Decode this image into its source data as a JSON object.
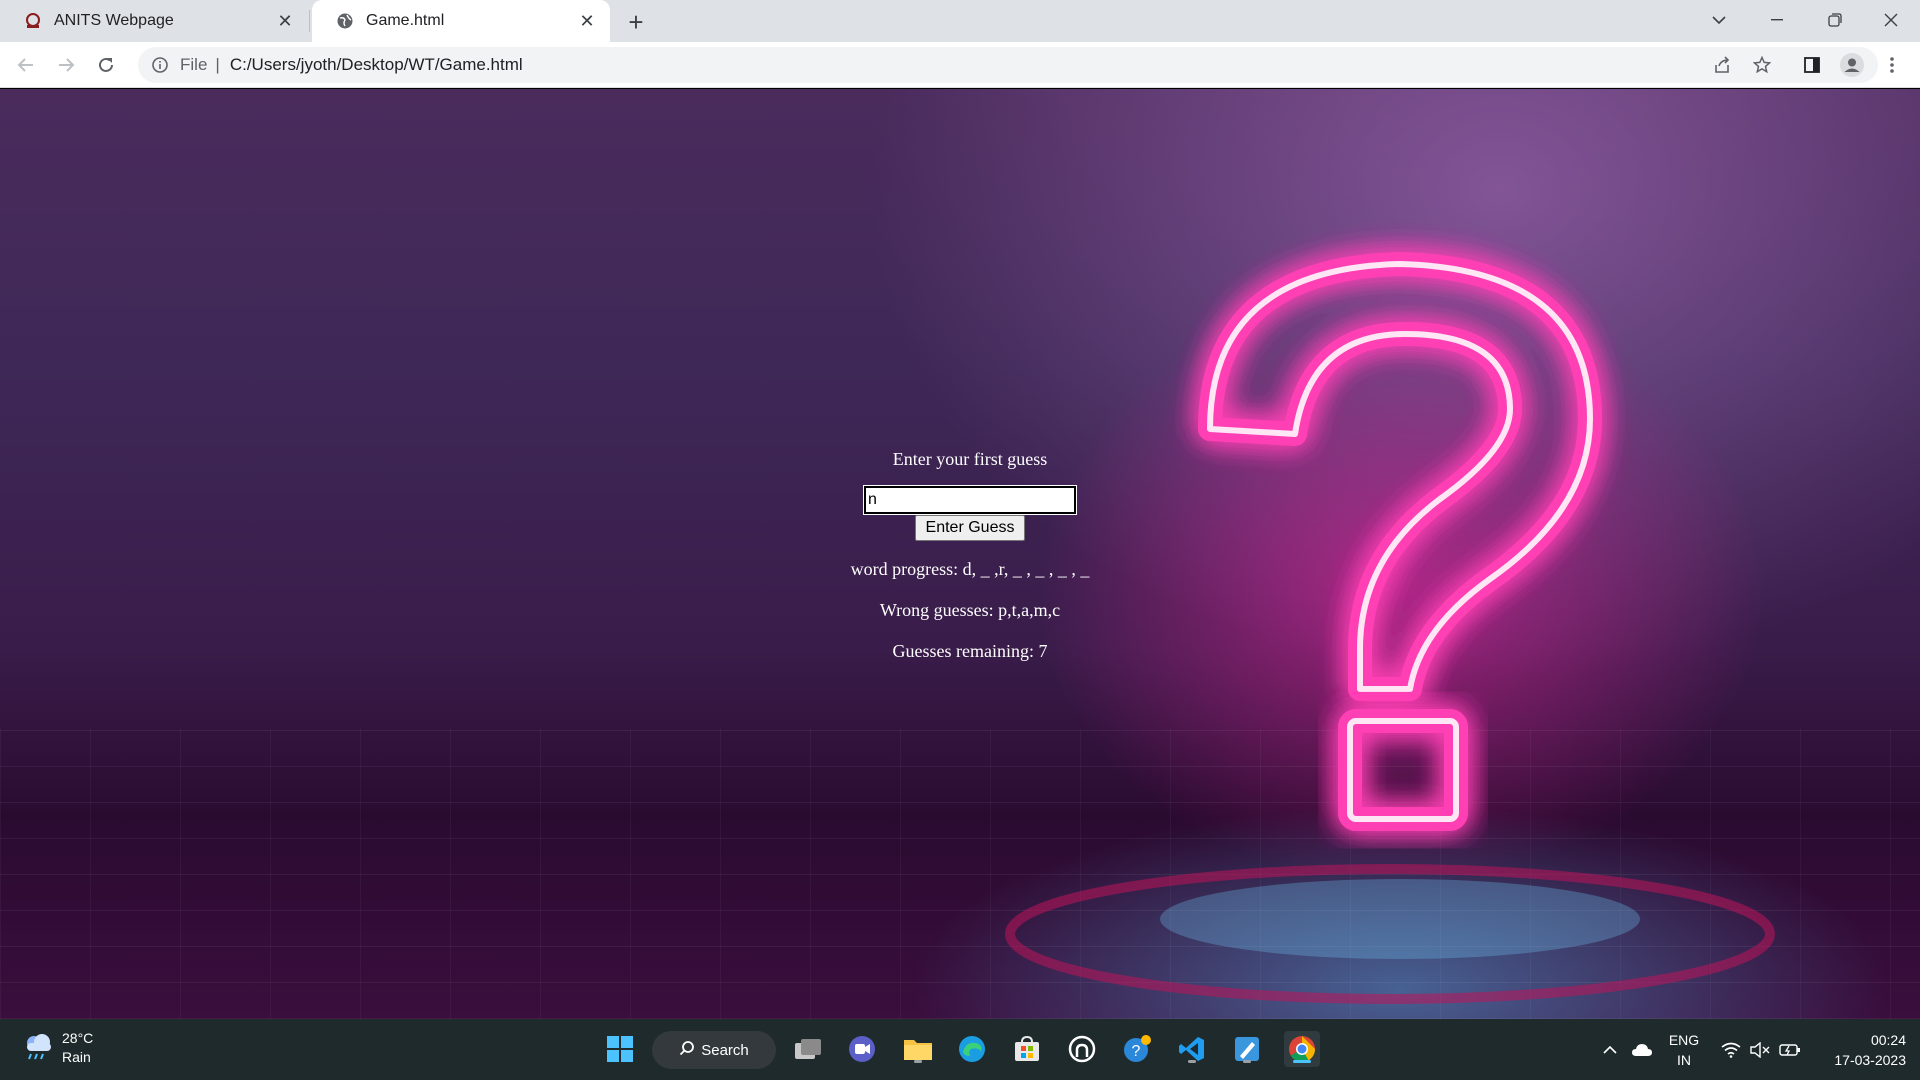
{
  "browser": {
    "tabs": [
      {
        "title": "ANITS Webpage",
        "active": false,
        "close": "✕"
      },
      {
        "title": "Game.html",
        "active": true,
        "close": "✕"
      }
    ],
    "new_tab": "+",
    "address": {
      "scheme": "File",
      "url": "C:/Users/jyoth/Desktop/WT/Game.html"
    }
  },
  "game": {
    "prompt": "Enter your first guess",
    "input_value": "n",
    "button_label": "Enter Guess",
    "progress": "word progress: d, _ ,r, _ , _ , _ , _",
    "wrong": "Wrong guesses: p,t,a,m,c",
    "remaining": "Guesses remaining: 7"
  },
  "taskbar": {
    "weather": {
      "temp": "28°C",
      "condition": "Rain"
    },
    "search_label": "Search",
    "language": {
      "line1": "ENG",
      "line2": "IN"
    },
    "clock": {
      "time": "00:24",
      "date": "17-03-2023"
    }
  },
  "colors": {
    "neon_pink": "#ff3fb4",
    "taskbar": "#1f2a2d",
    "accent": "#4cc2ff"
  }
}
